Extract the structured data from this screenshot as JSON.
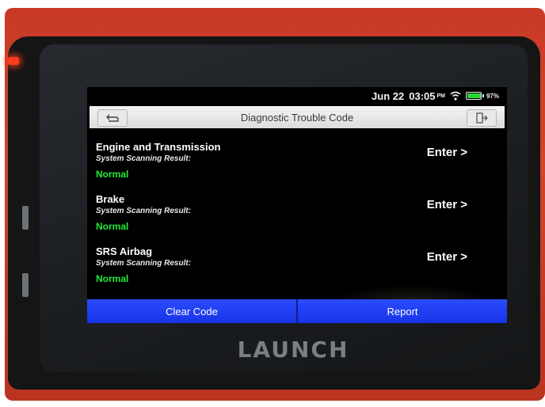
{
  "status_bar": {
    "date": "Jun 22",
    "time": "03:05",
    "ampm": "PM",
    "battery_pct": "97%",
    "battery_level": 0.97
  },
  "header": {
    "title": "Diagnostic Trouble Code"
  },
  "systems": [
    {
      "name": "Engine and Transmission",
      "label": "System Scanning Result:",
      "result": "Normal",
      "enter": "Enter >"
    },
    {
      "name": "Brake",
      "label": "System Scanning Result:",
      "result": "Normal",
      "enter": "Enter >"
    },
    {
      "name": "SRS Airbag",
      "label": "System Scanning Result:",
      "result": "Normal",
      "enter": "Enter >"
    }
  ],
  "footer": {
    "clear_label": "Clear Code",
    "report_label": "Report"
  },
  "device": {
    "brand": "LAUNCH"
  },
  "colors": {
    "result_normal": "#22e83a",
    "button_blue": "#1f3df0",
    "case_red": "#c83a26"
  }
}
